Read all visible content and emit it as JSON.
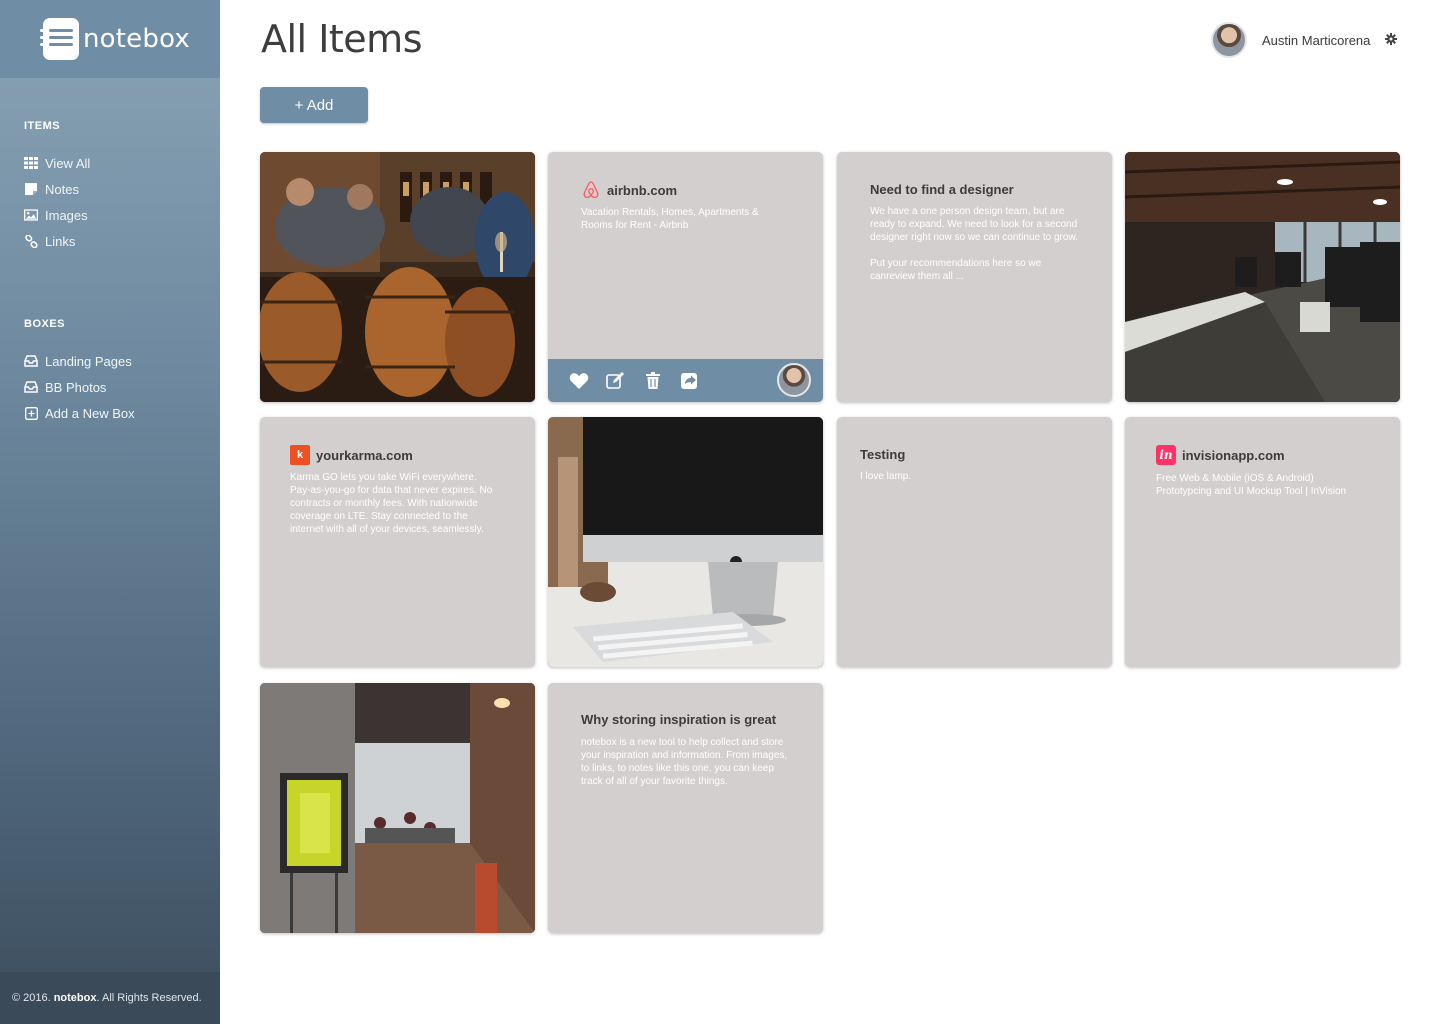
{
  "brand": {
    "name": "notebox"
  },
  "sidebar": {
    "items_heading": "ITEMS",
    "items": [
      {
        "label": "View All",
        "icon": "grid-icon"
      },
      {
        "label": "Notes",
        "icon": "note-icon"
      },
      {
        "label": "Images",
        "icon": "image-icon"
      },
      {
        "label": "Links",
        "icon": "link-icon"
      }
    ],
    "boxes_heading": "BOXES",
    "boxes": [
      {
        "label": "Landing Pages",
        "icon": "inbox-icon"
      },
      {
        "label": "BB Photos",
        "icon": "inbox-icon"
      },
      {
        "label": "Add a New Box",
        "icon": "plus-square-icon"
      }
    ]
  },
  "footer": {
    "prefix": "© 2016.",
    "brand": "notebox",
    "suffix": ". All Rights Reserved."
  },
  "header": {
    "title": "All Items",
    "add_label": "+ Add"
  },
  "user": {
    "name": "Austin Marticorena"
  },
  "cards": {
    "airbnb": {
      "site": "airbnb.com",
      "desc": "Vacation Rentals, Homes, Apartments & Rooms for Rent - Airbnb"
    },
    "designer": {
      "title": "Need to find a designer",
      "body": "We have a one person design team, but are ready to expand. We need to look for a second designer right now so we can continue to grow.\n\nPut your recommendations here so we canreview them all ..."
    },
    "karma": {
      "site": "yourkarma.com",
      "desc": "Karma GO lets you take WiFi everywhere. Pay-as-you-go for data that never expires. No contracts or monthly fees. With nationwide coverage on LTE. Stay connected to the internet with all of your devices, seamlessly."
    },
    "testing": {
      "title": "Testing",
      "body": "I love lamp."
    },
    "invision": {
      "site": "invisionapp.com",
      "desc": "Free Web & Mobile (iOS & Android) Prototypcing and UI Mockup Tool | InVision"
    },
    "inspiration": {
      "title": "Why storing inspiration is great",
      "body": "notebox is a new tool to help collect and store your inspiration and information. From images, to links, to notes like this one, you can keep track of all of your favorite things."
    }
  },
  "colors": {
    "accent": "#6f8ea6",
    "card": "#d3cfce",
    "airbnb": "#ff5a5f",
    "karma": "#f04e23",
    "invision": "#ff3366"
  }
}
